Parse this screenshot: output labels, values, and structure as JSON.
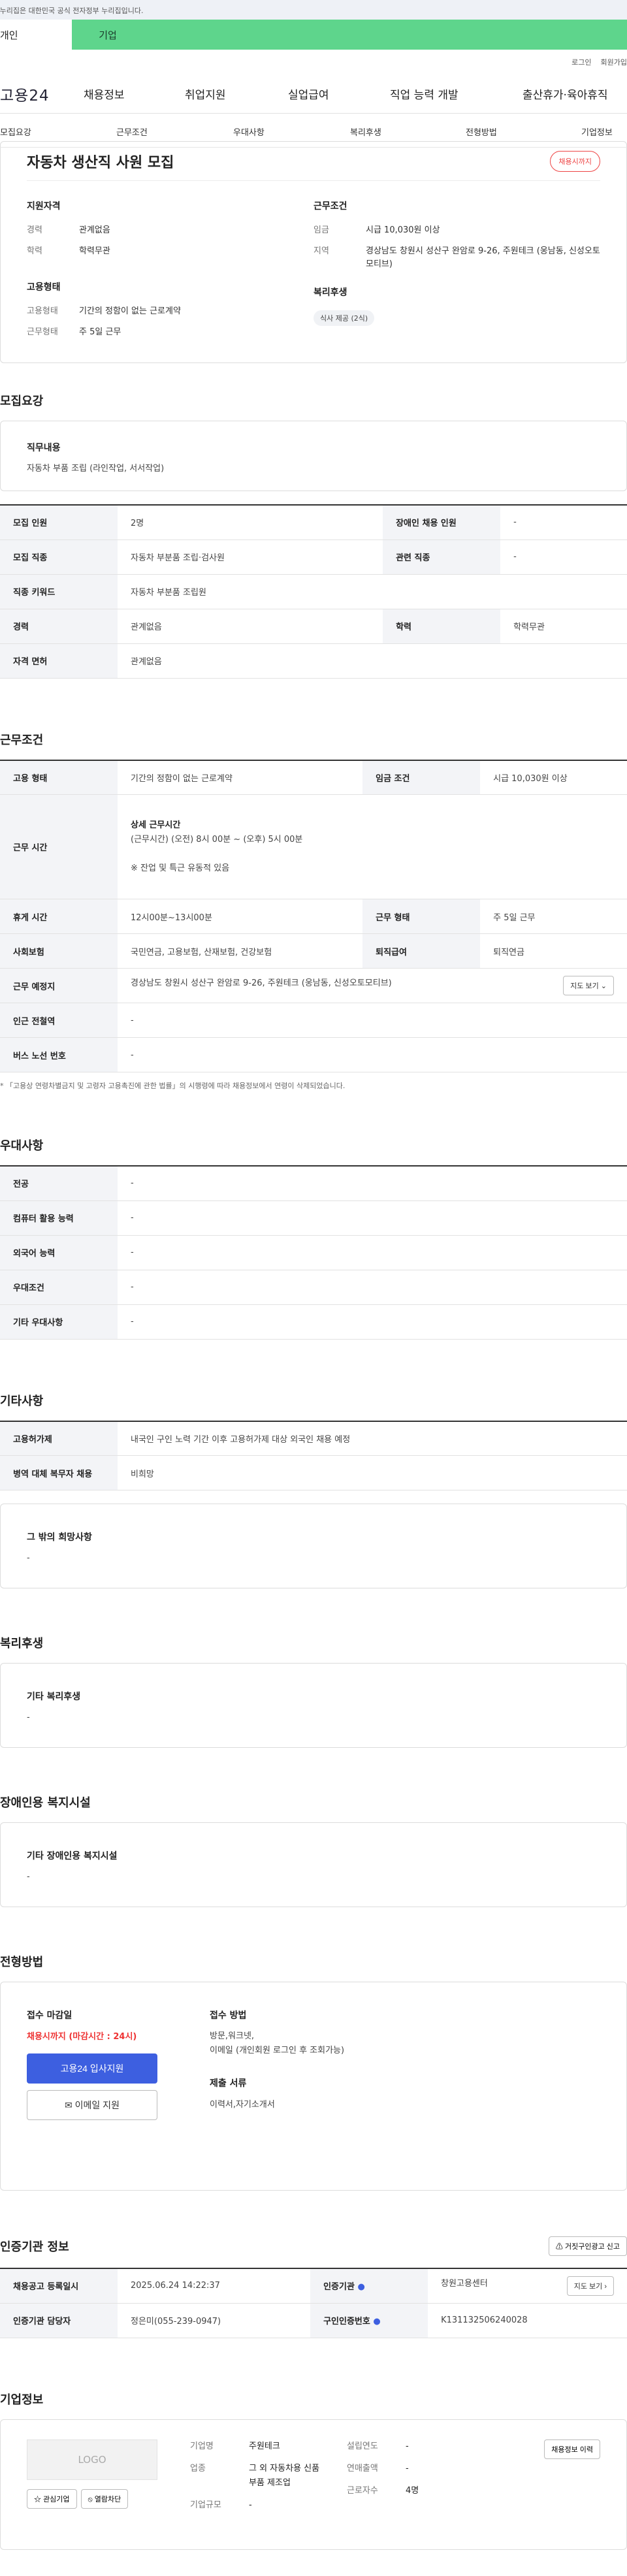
{
  "gov_banner": "이 누리집은 대한민국 공식 전자정부 누리집입니다.",
  "mode_tabs": [
    "개인",
    "기업"
  ],
  "util": {
    "login": "로그인",
    "join": "회원가입"
  },
  "logo": "고용24",
  "gnb": [
    "채용정보",
    "취업지원",
    "실업급여",
    "직업 능력 개발",
    "출산휴가·육아휴직"
  ],
  "subnav": [
    "모집요강",
    "근무조건",
    "우대사항",
    "복리후생",
    "전형방법",
    "기업정보"
  ],
  "summary": {
    "title": "자동차 생산직 사원 모집",
    "deadline_badge": "채용시까지",
    "qual_heading": "지원자격",
    "career_k": "경력",
    "career_v": "관계없음",
    "edu_k": "학력",
    "edu_v": "학력무관",
    "emp_heading": "고용형태",
    "emp_k": "고용형태",
    "emp_v": "기간의 정함이 없는 근로계약",
    "work_k": "근무형태",
    "work_v": "주 5일 근무",
    "cond_heading": "근무조건",
    "wage_k": "임금",
    "wage_v": "시급 10,030원 이상",
    "area_k": "지역",
    "area_v": "경상남도 창원시 성산구 완암로 9-26, 주원테크 (웅남동, 신성오토모티브)",
    "welfare_heading": "복리후생",
    "welfare_chip": "식사 제공 (2식)"
  },
  "recruit": {
    "title": "모집요강",
    "duty_heading": "직무내용",
    "duty_text": "자동차 부품 조립 (라인작업, 서서작업)",
    "rows": [
      [
        "모집 인원",
        "2명",
        "장애인 채용 인원",
        "-"
      ],
      [
        "모집 직종",
        "자동차 부분품 조립·검사원",
        "관련 직종",
        "-"
      ],
      [
        "직종 키워드",
        "자동차 부분품 조립원"
      ],
      [
        "경력",
        "관계없음",
        "학력",
        "학력무관"
      ],
      [
        "자격 면허",
        "관계없음"
      ]
    ]
  },
  "work": {
    "title": "근무조건",
    "type_k": "고용 형태",
    "type_v": "기간의 정함이 없는 근로계약",
    "wage_k": "임금 조건",
    "wage_v": "시급 10,030원 이상",
    "time_k": "근무 시간",
    "time_h": "상세 근무시간",
    "time_v": "(근무시간) (오전) 8시 00분 ~ (오후) 5시 00분",
    "time_note": "※ 잔업 및 특근 유동적 있음",
    "rest_k": "휴게 시간",
    "rest_v": "12시00분~13시00분",
    "form_k": "근무 형태",
    "form_v": "주 5일 근무",
    "ins_k": "사회보험",
    "ins_v": "국민연금, 고용보험, 산재보험, 건강보험",
    "retire_k": "퇴직급여",
    "retire_v": "퇴직연금",
    "place_k": "근무 예정지",
    "place_v": "경상남도 창원시 성산구 완암로 9-26, 주원테크 (웅남동, 신성오토모티브)",
    "map_btn": "지도 보기",
    "subway_k": "인근 전철역",
    "subway_v": "-",
    "bus_k": "버스 노선 번호",
    "bus_v": "-",
    "note": "* 「고용상 연령차별금지 및 고령자 고용촉진에 관한 법률」의 시행령에 따라 채용정보에서 연령이 삭제되었습니다."
  },
  "pref": {
    "title": "우대사항",
    "rows": [
      [
        "전공",
        "-"
      ],
      [
        "컴퓨터 활용 능력",
        "-"
      ],
      [
        "외국어 능력",
        "-"
      ],
      [
        "우대조건",
        "-"
      ],
      [
        "기타 우대사항",
        "-"
      ]
    ]
  },
  "etc": {
    "title": "기타사항",
    "rows": [
      [
        "고용허가제",
        "내국인 구인 노력 기간 이후 고용허가제 대상 외국인 채용 예정"
      ],
      [
        "병역 대체 복무자 채용",
        "비희망"
      ]
    ],
    "other_heading": "그 밖의 희망사항",
    "other_v": "-"
  },
  "welfare": {
    "title": "복리후생",
    "heading": "기타 복리후생",
    "value": "-"
  },
  "disabled": {
    "title": "장애인용 복지시설",
    "heading": "기타 장애인용 복지시설",
    "value": "-"
  },
  "apply": {
    "title": "전형방법",
    "deadline_h": "접수 마감일",
    "deadline_v": "채용시까지 (마감시간 : 24시)",
    "btn_apply": "고용24 입사지원",
    "btn_email": "이메일 지원",
    "method_h": "접수 방법",
    "method_v1": "방문,워크넷,",
    "method_v2": "이메일 (개인회원 로그인 후 조회가능)",
    "docs_h": "제출 서류",
    "docs_v": "이력서,자기소개서"
  },
  "org": {
    "title": "인증기관 정보",
    "report_btn": "거짓구인광고 신고",
    "reg_k": "채용공고 등록일시",
    "reg_v": "2025.06.24 14:22:37",
    "cert_k": "인증기관",
    "cert_v": "창원고용센터",
    "map_btn": "지도 보기",
    "mgr_k": "인증기관 담당자",
    "mgr_v": "정은미(055-239-0947)",
    "no_k": "구인인증번호",
    "no_v": "K131132506240028"
  },
  "company": {
    "title": "기업정보",
    "logo_ph": "LOGO",
    "fav_btn": "관심기업",
    "block_btn": "열람차단",
    "name_k": "기업명",
    "name_v": "주원테크",
    "biz_k": "업종",
    "biz_v": "그 외 자동차용 신품 부품 제조업",
    "scale_k": "기업규모",
    "scale_v": "-",
    "year_k": "설립연도",
    "year_v": "-",
    "sales_k": "연매출액",
    "sales_v": "-",
    "emp_k": "근로자수",
    "emp_v": "4명",
    "history_btn": "채용정보 이력"
  }
}
